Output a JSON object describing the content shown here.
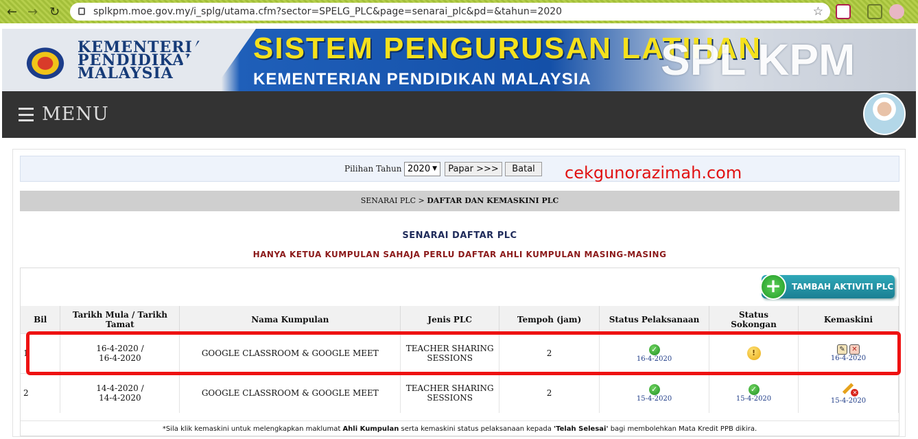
{
  "browser": {
    "url": "splkpm.moe.gov.my/i_splg/utama.cfm?sector=SPELG_PLC&page=senarai_plc&pd=&tahun=2020"
  },
  "banner": {
    "kementerian_line1": "KEMENTERIAN",
    "kementerian_line2": "PENDIDIKAN",
    "kementerian_line3": "MALAYSIA",
    "title": "SISTEM PENGURUSAN LATIHAN",
    "subtitle": "KEMENTERIAN PENDIDIKAN MALAYSIA",
    "brand": "SPL KPM"
  },
  "menu": {
    "label": "MENU"
  },
  "filter": {
    "label": "Pilihan Tahun",
    "year": "2020",
    "show_button": "Papar >>>",
    "cancel_button": "Batal"
  },
  "watermark": "cekgunorazimah.com",
  "breadcrumb": {
    "parent": "SENARAI PLC >",
    "current": "DAFTAR DAN KEMASKINI PLC"
  },
  "heading": "SENARAI DAFTAR PLC",
  "subheading": "HANYA KETUA KUMPULAN SAHAJA PERLU DAFTAR AHLI KUMPULAN MASING-MASING",
  "add_button": "TAMBAH AKTIVITI PLC",
  "table": {
    "headers": [
      "Bil",
      "Tarikh Mula / Tarikh Tamat",
      "Nama Kumpulan",
      "Jenis PLC",
      "Tempoh (jam)",
      "Status Pelaksanaan",
      "Status Sokongan",
      "Kemaskini"
    ],
    "rows": [
      {
        "bil": "1",
        "date_start": "16-4-2020 /",
        "date_end": "16-4-2020",
        "group": "GOOGLE CLASSROOM & GOOGLE MEET",
        "type_line1": "TEACHER SHARING",
        "type_line2": "SESSIONS",
        "hours": "2",
        "status_impl_date": "16-4-2020",
        "status_support_date": "",
        "update_date": "16-4-2020"
      },
      {
        "bil": "2",
        "date_start": "14-4-2020 /",
        "date_end": "14-4-2020",
        "group": "GOOGLE CLASSROOM & GOOGLE MEET",
        "type_line1": "TEACHER SHARING",
        "type_line2": "SESSIONS",
        "hours": "2",
        "status_impl_date": "15-4-2020",
        "status_support_date": "15-4-2020",
        "update_date": "15-4-2020"
      }
    ]
  },
  "note_parts": {
    "a": "*Sila klik kemaskini untuk melengkapkan maklumat ",
    "b": "Ahli Kumpulan",
    "c": " serta kemaskini status pelaksanaan kepada ",
    "d": "'Telah Selesai'",
    "e": " bagi membolehkan Mata Kredit PPB dikira."
  }
}
